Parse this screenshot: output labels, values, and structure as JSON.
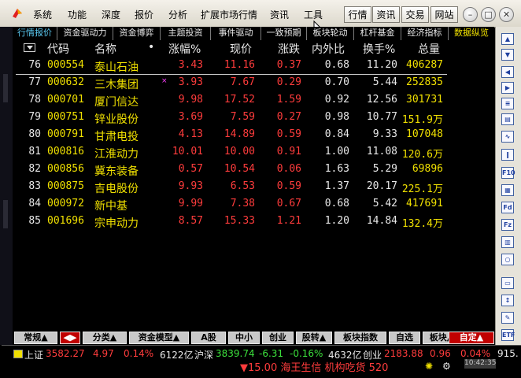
{
  "menubar": {
    "items": [
      "系统",
      "功能",
      "深度",
      "报价",
      "分析",
      "扩展市场行情",
      "资讯",
      "工具"
    ],
    "buttons": [
      "行情",
      "资讯",
      "交易",
      "网站"
    ]
  },
  "tabs": [
    "行情报价",
    "资金驱动力",
    "资金博弈",
    "主题投资",
    "事件驱动",
    "一致预期",
    "板块轮动",
    "杠杆基金",
    "经济指标",
    "数据纵览"
  ],
  "table": {
    "columns": [
      "代码",
      "名称",
      "涨幅%",
      "现价",
      "涨跌",
      "内外比",
      "换手%",
      "总量"
    ],
    "rows": [
      {
        "idx": "76",
        "code": "000554",
        "name": "泰山石油",
        "pct": "3.43",
        "price": "11.16",
        "chg": "0.37",
        "ratio": "0.68",
        "turnover": "11.20",
        "vol": "406287"
      },
      {
        "idx": "77",
        "code": "000632",
        "name": "三木集团",
        "pct": "3.93",
        "price": "7.67",
        "chg": "0.29",
        "ratio": "0.70",
        "turnover": "5.44",
        "vol": "252835"
      },
      {
        "idx": "78",
        "code": "000701",
        "name": "厦门信达",
        "pct": "9.98",
        "price": "17.52",
        "chg": "1.59",
        "ratio": "0.92",
        "turnover": "12.56",
        "vol": "301731"
      },
      {
        "idx": "79",
        "code": "000751",
        "name": "锌业股份",
        "pct": "3.69",
        "price": "7.59",
        "chg": "0.27",
        "ratio": "0.98",
        "turnover": "10.77",
        "vol": "151.9万"
      },
      {
        "idx": "80",
        "code": "000791",
        "name": "甘肃电投",
        "pct": "4.13",
        "price": "14.89",
        "chg": "0.59",
        "ratio": "0.84",
        "turnover": "9.33",
        "vol": "107048"
      },
      {
        "idx": "81",
        "code": "000816",
        "name": "江淮动力",
        "pct": "10.01",
        "price": "10.00",
        "chg": "0.91",
        "ratio": "1.00",
        "turnover": "11.08",
        "vol": "120.6万"
      },
      {
        "idx": "82",
        "code": "000856",
        "name": "冀东装备",
        "pct": "0.57",
        "price": "10.54",
        "chg": "0.06",
        "ratio": "1.63",
        "turnover": "5.29",
        "vol": "69896"
      },
      {
        "idx": "83",
        "code": "000875",
        "name": "吉电股份",
        "pct": "9.93",
        "price": "6.53",
        "chg": "0.59",
        "ratio": "1.37",
        "turnover": "20.17",
        "vol": "225.1万"
      },
      {
        "idx": "84",
        "code": "000972",
        "name": "新中基",
        "pct": "9.99",
        "price": "7.38",
        "chg": "0.67",
        "ratio": "0.68",
        "turnover": "5.42",
        "vol": "417691"
      },
      {
        "idx": "85",
        "code": "001696",
        "name": "宗申动力",
        "pct": "8.57",
        "price": "15.33",
        "chg": "1.21",
        "ratio": "1.20",
        "turnover": "14.84",
        "vol": "132.4万"
      }
    ]
  },
  "bottom_tabs": [
    "常规▲",
    "◀▶",
    "分类▲",
    "资金模型▲",
    "A股",
    "中小",
    "创业",
    "股转▲",
    "板块指数",
    "自选",
    "板块▲",
    "自定▲"
  ],
  "status": {
    "sh_label": "上证",
    "sh_val": "3582.27",
    "sh_chg": "4.97",
    "sh_pct": "0.14%",
    "sh_amt": "6122亿",
    "hs_label": "沪深",
    "hs_val": "3839.74",
    "hs_chg": "-6.31",
    "hs_pct": "-0.16%",
    "hs_amt": "4632亿",
    "cy_label": "创业",
    "cy_val": "2183.88",
    "cy_chg": "0.96",
    "cy_pct": "0.04%",
    "cy_more": "915.",
    "ticker": "▼15.00 海王生信  机构吃货 520",
    "clock": "10:42:35"
  },
  "colors": {
    "up": "#ff3c3c",
    "down": "#3ce03c",
    "code": "#f0e000",
    "header": "#e8e8e8"
  }
}
